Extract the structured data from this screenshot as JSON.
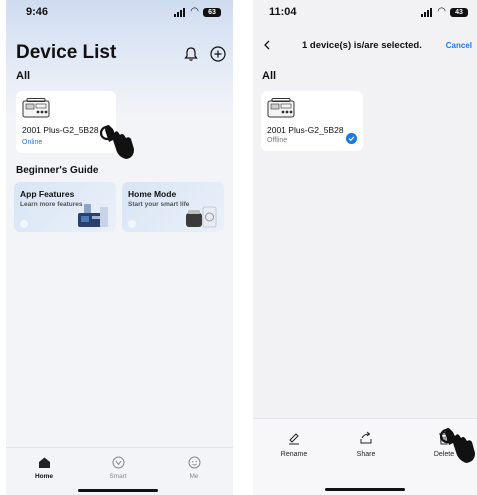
{
  "left": {
    "status": {
      "time": "9:46",
      "battery": "63"
    },
    "title": "Device List",
    "section_all": "All",
    "device": {
      "name": "2001 Plus-G2_5B28",
      "status": "Online"
    },
    "guide_title": "Beginner's Guide",
    "guides": [
      {
        "title": "App Features",
        "subtitle": "Learn more features"
      },
      {
        "title": "Home Mode",
        "subtitle": "Start your smart life"
      }
    ],
    "tabs": [
      {
        "label": "Home"
      },
      {
        "label": "Smart"
      },
      {
        "label": "Me"
      }
    ]
  },
  "right": {
    "status": {
      "time": "11:04",
      "battery": "43"
    },
    "header": {
      "title": "1 device(s) is/are selected.",
      "cancel": "Cancel"
    },
    "section_all": "All",
    "device": {
      "name": "2001 Plus-G2_5B28",
      "status": "Offline"
    },
    "actions": [
      {
        "label": "Rename"
      },
      {
        "label": "Share"
      },
      {
        "label": "Delete"
      }
    ]
  },
  "colors": {
    "accent": "#1e7ad8",
    "background": "#f3f4f7",
    "card": "#ffffff"
  }
}
